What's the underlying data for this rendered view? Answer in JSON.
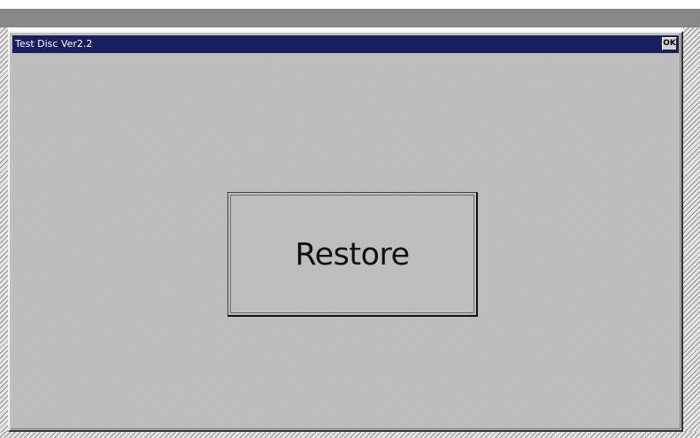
{
  "window": {
    "title": "Test Disc Ver2.2",
    "ok_label": "OK"
  },
  "main": {
    "restore_label": "Restore"
  },
  "colors": {
    "title_bar": "#1a1e5e",
    "dialog_face": "#c0c0c0",
    "top_bar": "#888888"
  }
}
